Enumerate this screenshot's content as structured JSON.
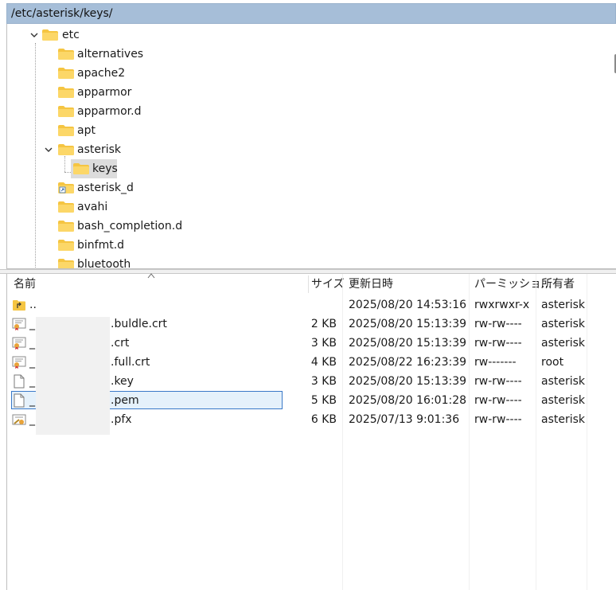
{
  "path_bar": {
    "path": "/etc/asterisk/keys/"
  },
  "tree": {
    "root": {
      "label": "etc",
      "expanded": true
    },
    "items": [
      {
        "label": "alternatives",
        "icon": "folder-icon"
      },
      {
        "label": "apache2",
        "icon": "folder-icon"
      },
      {
        "label": "apparmor",
        "icon": "folder-icon"
      },
      {
        "label": "apparmor.d",
        "icon": "folder-icon"
      },
      {
        "label": "apt",
        "icon": "folder-icon"
      },
      {
        "label": "asterisk",
        "icon": "folder-icon",
        "expanded": true
      },
      {
        "label": "keys",
        "icon": "folder-icon",
        "selected": true
      },
      {
        "label": "asterisk_d",
        "icon": "folder-link-icon"
      },
      {
        "label": "avahi",
        "icon": "folder-icon"
      },
      {
        "label": "bash_completion.d",
        "icon": "folder-icon"
      },
      {
        "label": "binfmt.d",
        "icon": "folder-icon"
      },
      {
        "label": "bluetooth",
        "icon": "folder-icon"
      }
    ]
  },
  "file_list": {
    "columns": {
      "name": "名前",
      "size": "サイズ",
      "modified": "更新日時",
      "permissions": "パーミッショ...",
      "owner": "所有者"
    },
    "rows": [
      {
        "icon": "parent-folder-icon",
        "name": "..",
        "size": "",
        "modified": "2025/08/20 14:53:16",
        "permissions": "rwxrwxr-x",
        "owner": "asterisk"
      },
      {
        "icon": "certificate-icon",
        "name": "_",
        "name_suffix": ".buldle.crt",
        "size": "2 KB",
        "modified": "2025/08/20 15:13:39",
        "permissions": "rw-rw----",
        "owner": "asterisk"
      },
      {
        "icon": "certificate-icon",
        "name": "_",
        "name_suffix": ".crt",
        "size": "3 KB",
        "modified": "2025/08/20 15:13:39",
        "permissions": "rw-rw----",
        "owner": "asterisk"
      },
      {
        "icon": "certificate-icon",
        "name": "_",
        "name_suffix": ".full.crt",
        "size": "4 KB",
        "modified": "2025/08/22 16:23:39",
        "permissions": "rw-------",
        "owner": "root"
      },
      {
        "icon": "file-icon",
        "name": "_",
        "name_suffix": ".key",
        "size": "3 KB",
        "modified": "2025/08/20 15:13:39",
        "permissions": "rw-rw----",
        "owner": "asterisk"
      },
      {
        "icon": "file-icon",
        "name": "_",
        "name_suffix": ".pem",
        "size": "5 KB",
        "modified": "2025/08/20 16:01:28",
        "permissions": "rw-rw----",
        "owner": "asterisk",
        "selected": true
      },
      {
        "icon": "pfx-icon",
        "name": "_",
        "name_suffix": ".pfx",
        "size": "6 KB",
        "modified": "2025/07/13 9:01:36",
        "permissions": "rw-rw----",
        "owner": "asterisk"
      }
    ]
  }
}
